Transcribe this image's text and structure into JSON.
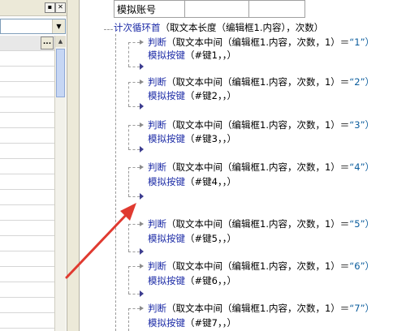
{
  "panel": {
    "title_buttons": [
      "▪",
      "✕"
    ],
    "ellipsis_label": "..."
  },
  "table": {
    "header": "模拟账号"
  },
  "code": {
    "loop_keyword": "计次循环首",
    "loop_args": "（取文本长度（编辑框1.内容），次数）",
    "judge_keyword": "判断",
    "key_keyword": "模拟按键",
    "blocks": [
      {
        "cond": "（取文本中间（编辑框1.内容，次数，1）＝",
        "str": "“1”）",
        "key_args": "（#键1，，）"
      },
      {
        "cond": "（取文本中间（编辑框1.内容，次数，1）＝",
        "str": "“2”）",
        "key_args": "（#键2，，）"
      },
      {
        "cond": "（取文本中间（编辑框1.内容，次数，1）＝",
        "str": "“3”）",
        "key_args": "（#键3，，）"
      },
      {
        "cond": "（取文本中间（编辑框1.内容，次数，1）＝",
        "str": "“4”）",
        "key_args": "（#键4，，）"
      },
      {
        "cond": "（取文本中间（编辑框1.内容，次数，1）＝",
        "str": "“5”）",
        "key_args": "（#键5，，）"
      },
      {
        "cond": "（取文本中间（编辑框1.内容，次数，1）＝",
        "str": "“6”）",
        "key_args": "（#键6，，）"
      },
      {
        "cond": "（取文本中间（编辑框1.内容，次数，1）＝",
        "str": "“7”）",
        "key_args": "（#键7，，）"
      }
    ]
  },
  "colors": {
    "keyword": "#1b2aa6",
    "string": "#0a5c9c",
    "annotation_arrow": "#e03a30"
  },
  "icons": {
    "annotation": "red-arrow-icon"
  }
}
